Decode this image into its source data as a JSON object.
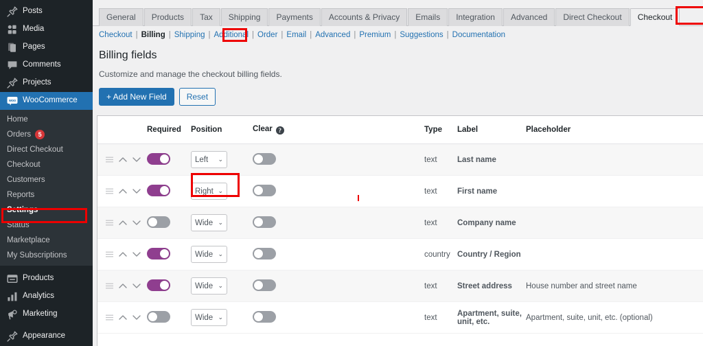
{
  "colors": {
    "sidebar_bg": "#1d2327",
    "submenu_bg": "#2c3338",
    "active_blue": "#2271b1",
    "toggle_on": "#8f3e8f",
    "toggle_off": "#9ca0a6",
    "highlight_red": "#ee0000",
    "badge_red": "#d63638"
  },
  "sidebar": {
    "top_items": [
      {
        "label": "Posts",
        "icon": "pin-icon"
      },
      {
        "label": "Media",
        "icon": "media-icon"
      },
      {
        "label": "Pages",
        "icon": "pages-icon"
      },
      {
        "label": "Comments",
        "icon": "comment-icon"
      },
      {
        "label": "Projects",
        "icon": "pin-icon"
      }
    ],
    "woocommerce": {
      "label": "WooCommerce",
      "icon": "woocommerce-icon",
      "active": true
    },
    "submenu": [
      {
        "label": "Home",
        "badge": null,
        "current": false
      },
      {
        "label": "Orders",
        "badge": "5",
        "current": false
      },
      {
        "label": "Direct Checkout",
        "badge": null,
        "current": false
      },
      {
        "label": "Checkout",
        "badge": null,
        "current": false
      },
      {
        "label": "Customers",
        "badge": null,
        "current": false
      },
      {
        "label": "Reports",
        "badge": null,
        "current": false
      },
      {
        "label": "Settings",
        "badge": null,
        "current": true
      },
      {
        "label": "Status",
        "badge": null,
        "current": false
      },
      {
        "label": "Marketplace",
        "badge": null,
        "current": false
      },
      {
        "label": "My Subscriptions",
        "badge": null,
        "current": false
      }
    ],
    "bottom_items": [
      {
        "label": "Products",
        "icon": "products-icon"
      },
      {
        "label": "Analytics",
        "icon": "analytics-icon"
      },
      {
        "label": "Marketing",
        "icon": "marketing-icon"
      },
      {
        "label": "Appearance",
        "icon": "appearance-icon"
      }
    ]
  },
  "tabs": [
    {
      "label": "General",
      "active": false
    },
    {
      "label": "Products",
      "active": false
    },
    {
      "label": "Tax",
      "active": false
    },
    {
      "label": "Shipping",
      "active": false
    },
    {
      "label": "Payments",
      "active": false
    },
    {
      "label": "Accounts & Privacy",
      "active": false
    },
    {
      "label": "Emails",
      "active": false
    },
    {
      "label": "Integration",
      "active": false
    },
    {
      "label": "Advanced",
      "active": false
    },
    {
      "label": "Direct Checkout",
      "active": false
    },
    {
      "label": "Checkout",
      "active": true
    }
  ],
  "subnav": [
    {
      "label": "Checkout",
      "current": false
    },
    {
      "label": "Billing",
      "current": true
    },
    {
      "label": "Shipping",
      "current": false
    },
    {
      "label": "Additional",
      "current": false
    },
    {
      "label": "Order",
      "current": false
    },
    {
      "label": "Email",
      "current": false
    },
    {
      "label": "Advanced",
      "current": false
    },
    {
      "label": "Premium",
      "current": false
    },
    {
      "label": "Suggestions",
      "current": false
    },
    {
      "label": "Documentation",
      "current": false
    }
  ],
  "page": {
    "title": "Billing fields",
    "description": "Customize and manage the checkout billing fields.",
    "add_button": "+ Add New Field",
    "reset_button": "Reset"
  },
  "table": {
    "headers": {
      "handle": "",
      "required": "Required",
      "position": "Position",
      "clear": "Clear",
      "clear_help": "?",
      "type": "Type",
      "label": "Label",
      "placeholder": "Placeholder"
    },
    "rows": [
      {
        "required": true,
        "position": "Left",
        "clear": false,
        "type": "text",
        "label": "Last name",
        "placeholder": ""
      },
      {
        "required": true,
        "position": "Right",
        "clear": false,
        "type": "text",
        "label": "First name",
        "placeholder": ""
      },
      {
        "required": false,
        "position": "Wide",
        "clear": false,
        "type": "text",
        "label": "Company name",
        "placeholder": ""
      },
      {
        "required": true,
        "position": "Wide",
        "clear": false,
        "type": "country",
        "label": "Country / Region",
        "placeholder": ""
      },
      {
        "required": true,
        "position": "Wide",
        "clear": false,
        "type": "text",
        "label": "Street address",
        "placeholder": "House number and street name"
      },
      {
        "required": false,
        "position": "Wide",
        "clear": false,
        "type": "text",
        "label": "Apartment, suite, unit, etc.",
        "placeholder": "Apartment, suite, unit, etc. (optional)"
      }
    ]
  },
  "highlights": [
    {
      "name": "checkout-tab-highlight"
    },
    {
      "name": "billing-link-highlight"
    },
    {
      "name": "settings-menu-highlight"
    },
    {
      "name": "row-handle-highlight"
    }
  ]
}
